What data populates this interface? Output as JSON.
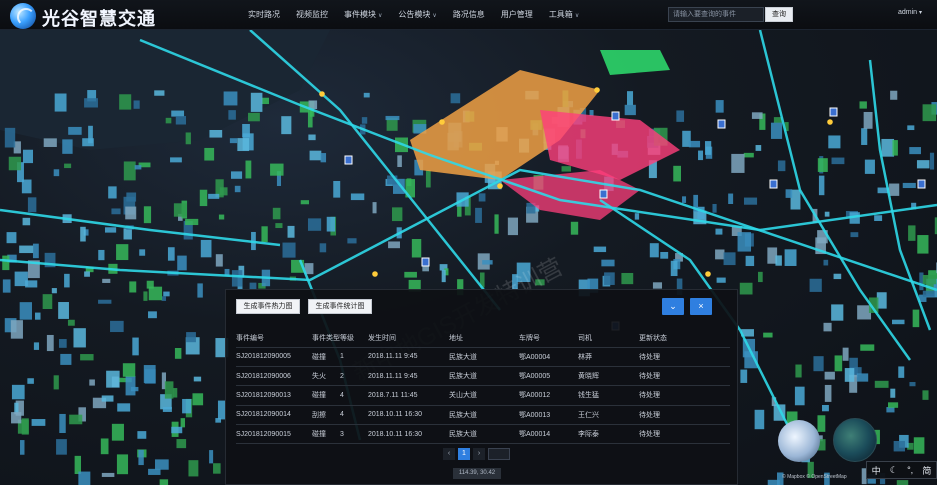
{
  "header": {
    "app_title": "光谷智慧交通",
    "nav": [
      {
        "label": "实时路况",
        "has_caret": false
      },
      {
        "label": "视频监控",
        "has_caret": false
      },
      {
        "label": "事件模块",
        "has_caret": true
      },
      {
        "label": "公告模块",
        "has_caret": true
      },
      {
        "label": "路况信息",
        "has_caret": false
      },
      {
        "label": "用户管理",
        "has_caret": false
      },
      {
        "label": "工具箱",
        "has_caret": true
      }
    ],
    "search_placeholder": "请输入要查询的事件",
    "search_button": "查询",
    "user": "admin"
  },
  "map": {
    "watermark": "新中地GIS开发特训营",
    "colors": {
      "road": "#2fd8e8",
      "building_blue": "#4aa9d6",
      "building_green": "#36b85a",
      "zone_orange": "#f0a044",
      "zone_pink": "#ff3f7c"
    }
  },
  "panel": {
    "buttons": {
      "heatmap": "生成事件热力图",
      "stats": "生成事件统计图"
    },
    "columns": [
      "事件编号",
      "事件类型",
      "等级",
      "发生时间",
      "地址",
      "车牌号",
      "司机",
      "更新状态"
    ],
    "rows": [
      [
        "SJ201812090005",
        "碰撞",
        "1",
        "2018.11.11 9:45",
        "民族大道",
        "鄂A00004",
        "林莽",
        "待处理"
      ],
      [
        "SJ201812090006",
        "失火",
        "2",
        "2018.11.11 9:45",
        "民族大道",
        "鄂A00005",
        "黄晓辉",
        "待处理"
      ],
      [
        "SJ201812090013",
        "碰撞",
        "4",
        "2018.7.11 11:45",
        "关山大道",
        "鄂A00012",
        "钱生猛",
        "待处理"
      ],
      [
        "SJ201812090014",
        "刮擦",
        "4",
        "2018.10.11 16:30",
        "民族大道",
        "鄂A00013",
        "王仁兴",
        "待处理"
      ],
      [
        "SJ201812090015",
        "碰撞",
        "3",
        "2018.10.11 16:30",
        "民族大道",
        "鄂A00014",
        "李际泰",
        "待处理"
      ]
    ],
    "pager": {
      "prev": "‹",
      "current": "1",
      "next": "›"
    },
    "coordinates": "114.39, 30.42"
  },
  "footer": {
    "attribution": "© Mapbox © OpenStreetMap",
    "ime": [
      "中",
      "简"
    ]
  }
}
